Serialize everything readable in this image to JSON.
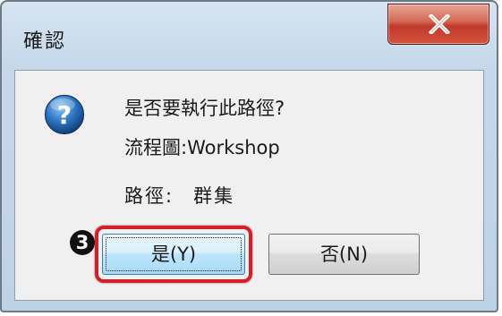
{
  "window": {
    "title": "確認",
    "close_icon": "close-x-icon"
  },
  "message": {
    "icon": "question-icon",
    "line1": "是否要執行此路徑?",
    "line2": "流程圖:Workshop",
    "path_label": "路徑:",
    "path_value": "群集"
  },
  "annotation": {
    "step_number": "3",
    "highlight_color": "#d2202a"
  },
  "buttons": {
    "yes_label": "是(Y)",
    "no_label": "否(N)"
  },
  "colors": {
    "close_button": "#c0392b",
    "icon_blue": "#1f5fa8"
  }
}
